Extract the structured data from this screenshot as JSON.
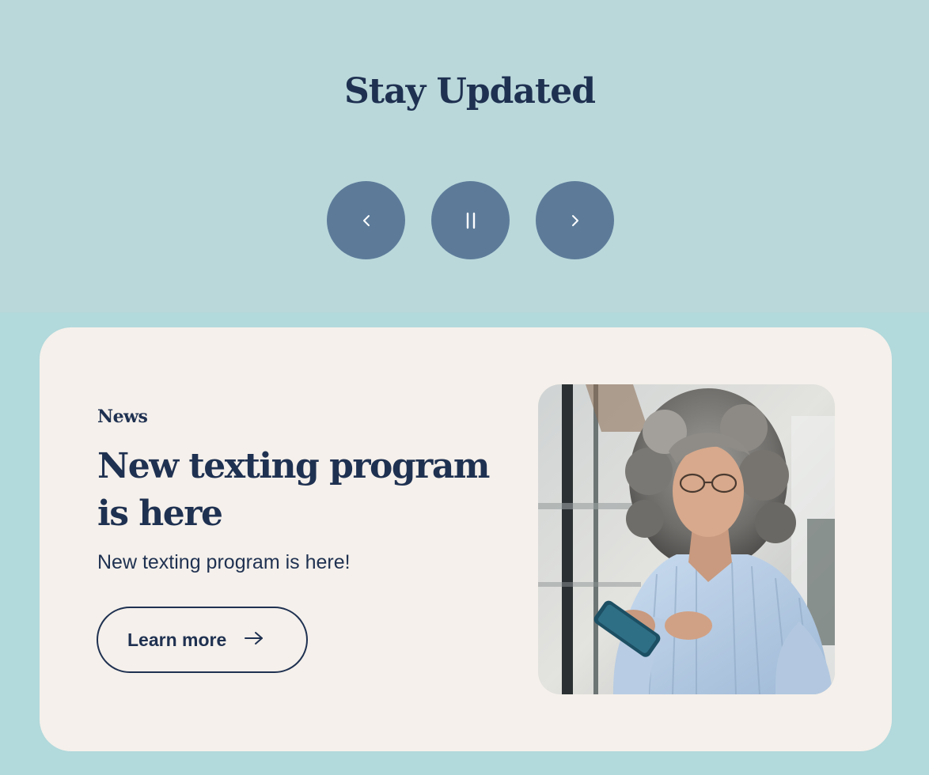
{
  "section": {
    "title": "Stay Updated"
  },
  "carousel": {
    "prev_icon": "chevron-left-icon",
    "pause_icon": "pause-icon",
    "next_icon": "chevron-right-icon"
  },
  "card": {
    "eyebrow": "News",
    "title": "New texting program is here",
    "description": "New texting program is here!",
    "cta_label": "Learn more",
    "cta_icon": "arrow-right-icon",
    "image": "woman-texting-on-phone-photo"
  },
  "colors": {
    "background": "#b2d9dc",
    "card_background": "#f5f0eb",
    "text_navy": "#1f3151",
    "control_button": "#5d7b99"
  }
}
